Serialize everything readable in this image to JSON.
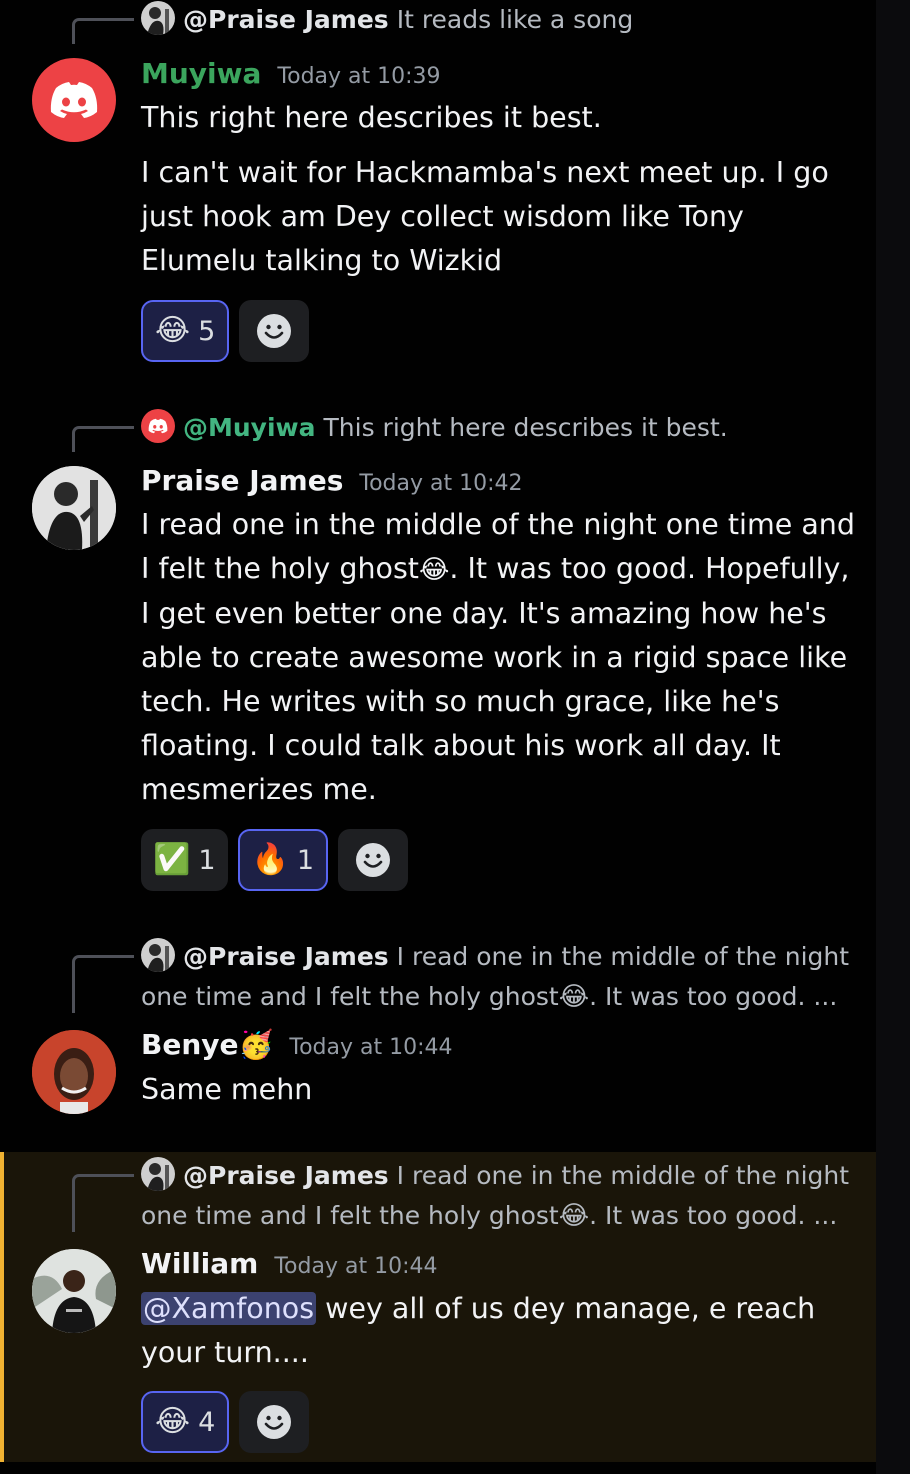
{
  "colors": {
    "background": "#010101",
    "username_green": "#3ba55d",
    "timestamp": "#949ba4",
    "highlight_border": "#f0b232",
    "reaction_active_border": "#5865f2",
    "mention_bg": "#3c4270"
  },
  "top_partial": {
    "reply_name": "@Praise James",
    "reply_text": "It reads like a song"
  },
  "messages": [
    {
      "author": "Muyiwa",
      "avatar_icon": "discord-logo-icon",
      "timestamp": "Today at 10:39",
      "lines": [
        "This right here describes it best."
      ],
      "paragraph": "I can't wait for Hackmamba's next meet up. I go just hook am Dey collect wisdom like Tony Elumelu talking to Wizkid",
      "reactions": [
        {
          "emoji": "😂",
          "emoji_name": "joy-emoji",
          "count": "5",
          "active": true
        }
      ]
    },
    {
      "reply_name": "@Muyiwa",
      "reply_text": "This right here describes it best.",
      "author": "Praise James",
      "timestamp": "Today at 10:42",
      "text_part1": "I read one in the middle of the night  one time and I felt the holy ghost",
      "text_emoji": "😂",
      "text_part2": ". It was too good. Hopefully, I get even better one day. It's amazing how he's able to create awesome work in a rigid space like tech. He writes with so much grace, like he's floating. I could talk about his work all day. It mesmerizes me.",
      "reactions": [
        {
          "emoji": "✅",
          "emoji_name": "check-mark-emoji",
          "count": "1",
          "active": false
        },
        {
          "emoji": "🔥",
          "emoji_name": "fire-emoji",
          "count": "1",
          "active": true
        }
      ]
    },
    {
      "reply_name": "@Praise James",
      "reply_text_part1": "I read one in the middle of the night one time and I felt the holy ghost",
      "reply_emoji": "😂",
      "reply_text_part2": ". It was too good. ...",
      "author": "Benye",
      "author_emoji": "🥳",
      "timestamp": "Today at 10:44",
      "text": "Same mehn"
    },
    {
      "reply_name": "@Praise James",
      "reply_text_part1": "I read one in the middle of the night one time and I felt the holy ghost",
      "reply_emoji": "😂",
      "reply_text_part2": ". It was too good. ...",
      "author": "William",
      "timestamp": "Today at 10:44",
      "mention": "@Xamfonos",
      "text": " wey all of us dey manage, e reach your turn....",
      "reactions": [
        {
          "emoji": "😂",
          "emoji_name": "joy-emoji",
          "count": "4",
          "active": true
        }
      ]
    }
  ]
}
